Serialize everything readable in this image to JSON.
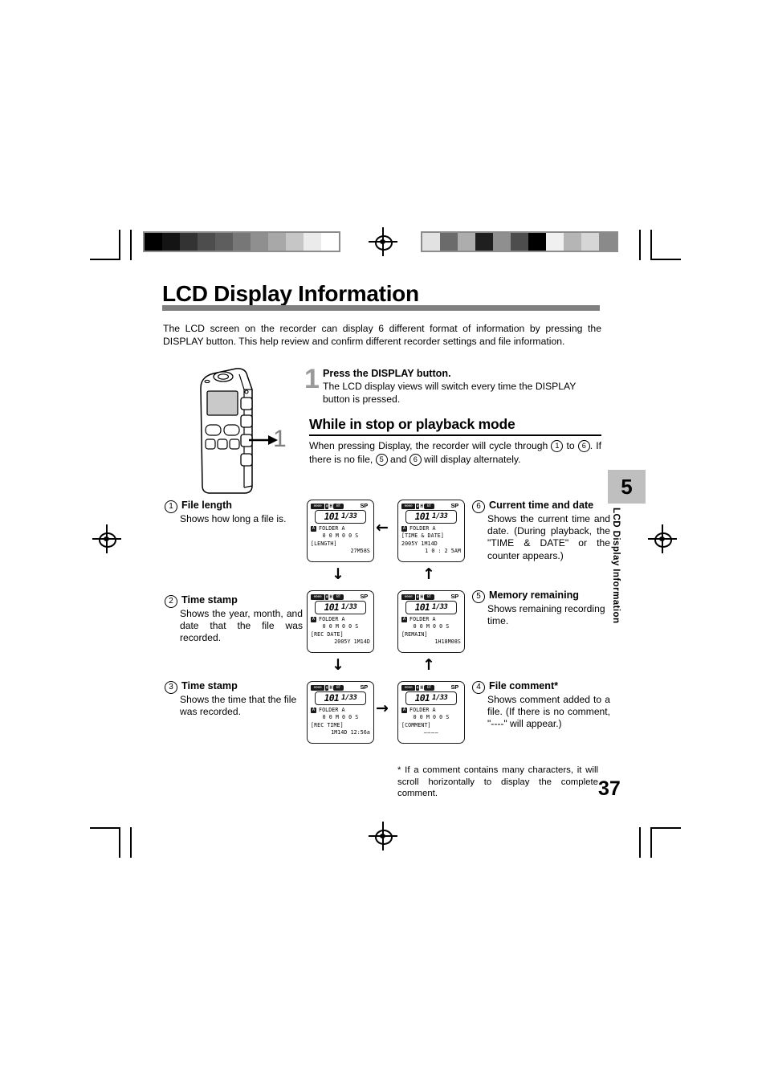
{
  "document": {
    "title": "LCD Display Information",
    "intro": "The LCD screen on the recorder can display 6 different format of information by pressing the DISPLAY button. This help review and confirm different recorder settings and file information.",
    "page_number": "37"
  },
  "chapter_tab": {
    "number": "5",
    "label": "LCD Display Information"
  },
  "step": {
    "number": "1",
    "title_pre": "Press the ",
    "title_strong": "DISPLAY",
    "title_post": " button.",
    "body": "The LCD display views will switch every time the DISPLAY button is pressed."
  },
  "section": {
    "heading": "While in stop or playback mode",
    "body_part1": "When pressing Display, the recorder will cycle through ",
    "body_c1": "1",
    "body_part2": " to ",
    "body_c6": "6",
    "body_part3": ". If there is no file, ",
    "body_c5": "5",
    "body_part4": " and ",
    "body_c6b": "6",
    "body_part5": " will display alternately."
  },
  "callout": {
    "number": "1"
  },
  "items": [
    {
      "num": "1",
      "title": "File length",
      "desc": "Shows how long a file is."
    },
    {
      "num": "2",
      "title": "Time stamp",
      "desc": "Shows the year, month, and date that the file was recorded."
    },
    {
      "num": "3",
      "title": "Time stamp",
      "desc": "Shows the time that the file was recorded."
    },
    {
      "num": "4",
      "title": "File comment*",
      "desc": "Shows comment added to a file. (If there is no comment, \"----\" will appear.)"
    },
    {
      "num": "5",
      "title": "Memory remaining",
      "desc": "Shows remaining recording time."
    },
    {
      "num": "6",
      "title": "Current time and date",
      "desc": "Shows the current time and date. (During playback, the \"TIME & DATE\" or the counter appears.)"
    }
  ],
  "lcd_screens": [
    {
      "id": "lcd-file-length",
      "mode": "SP",
      "file_number": "101",
      "file_total": "1/33",
      "folder_badge": "A",
      "folder": "FOLDER A",
      "counter": "0 0 M 0 0 S",
      "field_label": "[LENGTH]",
      "value": "27M58S"
    },
    {
      "id": "lcd-time-date",
      "mode": "SP",
      "file_number": "101",
      "file_total": "1/33",
      "folder_badge": "A",
      "folder": "FOLDER A",
      "counter": "",
      "field_label": "[TIME & DATE]",
      "value_line1": "2005Y 1M14D",
      "value": "1 0 : 2 5AM"
    },
    {
      "id": "lcd-rec-date",
      "mode": "SP",
      "file_number": "101",
      "file_total": "1/33",
      "folder_badge": "A",
      "folder": "FOLDER A",
      "counter": "0 0 M 0 0 S",
      "field_label": "[REC DATE]",
      "value": "2005Y 1M14D"
    },
    {
      "id": "lcd-remain",
      "mode": "SP",
      "file_number": "101",
      "file_total": "1/33",
      "folder_badge": "A",
      "folder": "FOLDER A",
      "counter": "0 0 M 0 0 S",
      "field_label": "[REMAIN]",
      "value": "1H18M08S"
    },
    {
      "id": "lcd-rec-time",
      "mode": "SP",
      "file_number": "101",
      "file_total": "1/33",
      "folder_badge": "A",
      "folder": "FOLDER A",
      "counter": "0 0 M 0 0 S",
      "field_label": "[REC TIME]",
      "value": "1M14D 12:56a"
    },
    {
      "id": "lcd-comment",
      "mode": "SP",
      "file_number": "101",
      "file_total": "1/33",
      "folder_badge": "A",
      "folder": "FOLDER A",
      "counter": "0 0 M 0 0 S",
      "field_label": "[COMMENT]",
      "value": "————"
    }
  ],
  "lcd_icons": {
    "rec_indicator": "eeee",
    "mic": "ψ",
    "hq": "H",
    "battery": "BT"
  },
  "arrows": {
    "left": "←",
    "right": "→",
    "down": "↓",
    "up": "↑"
  },
  "footnote": "* If a comment contains many characters, it will scroll horizontally to display the complete comment.",
  "registration": {
    "wedge_left": [
      "#000000",
      "#141414",
      "#333333",
      "#4d4d4d",
      "#5e5e5e",
      "#777777",
      "#8f8f8f",
      "#a8a8a8",
      "#c6c6c6",
      "#ebebeb",
      "#ffffff"
    ],
    "wedge_right": [
      "#e2e2e2",
      "#6b6b6b",
      "#adadad",
      "#1f1f1f",
      "#8f8f8f",
      "#4d4d4d",
      "#000000",
      "#f0f0f0",
      "#b5b5b5",
      "#d6d6d6",
      "#8a8a8a"
    ]
  }
}
